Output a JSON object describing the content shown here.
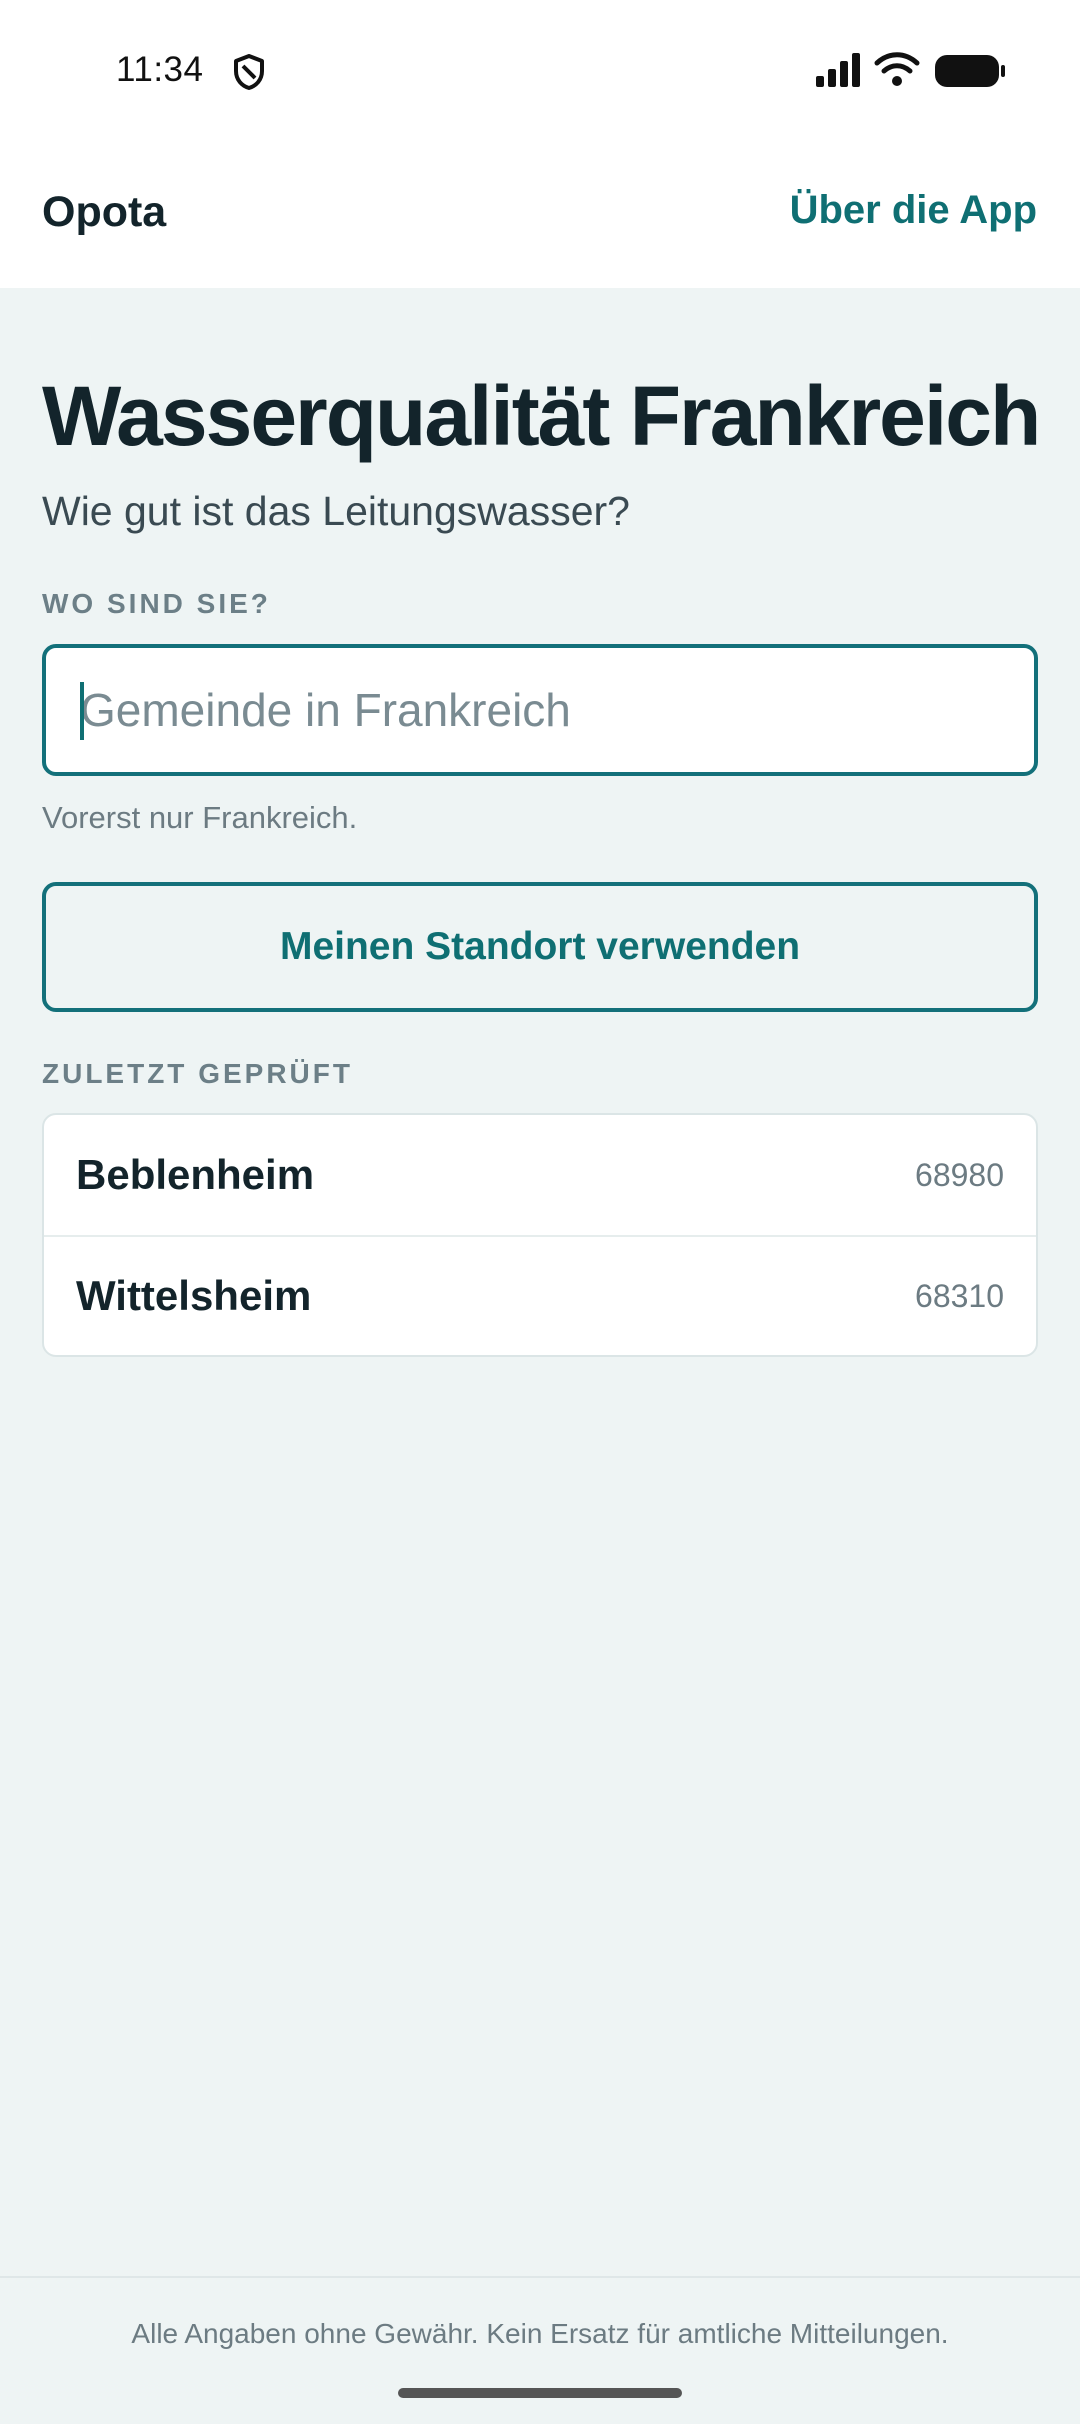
{
  "status_bar": {
    "time": "11:34",
    "icons": [
      "shield-icon",
      "signal-icon",
      "wifi-icon",
      "battery-icon"
    ]
  },
  "app_bar": {
    "app_name": "Opota",
    "about_link": "Über die App"
  },
  "main": {
    "title": "Wasserqualität Frankreich",
    "subtitle": "Wie gut ist das Leitungswasser?",
    "location_label": "WO SIND SIE?",
    "search": {
      "placeholder": "Gemeinde in Frankreich",
      "value": ""
    },
    "hint": "Vorerst nur Frankreich.",
    "locate_button": "Meinen Standort verwenden",
    "recent_label": "ZULETZT GEPRÜFT",
    "recent": [
      {
        "name": "Beblenheim",
        "zip": "68980"
      },
      {
        "name": "Wittelsheim",
        "zip": "68310"
      }
    ]
  },
  "footer": {
    "disclaimer": "Alle Angaben ohne Gewähr. Kein Ersatz für amtliche Mitteilungen."
  },
  "colors": {
    "accent": "#0f6f73",
    "background": "#eef4f4",
    "text": "#13242b"
  }
}
